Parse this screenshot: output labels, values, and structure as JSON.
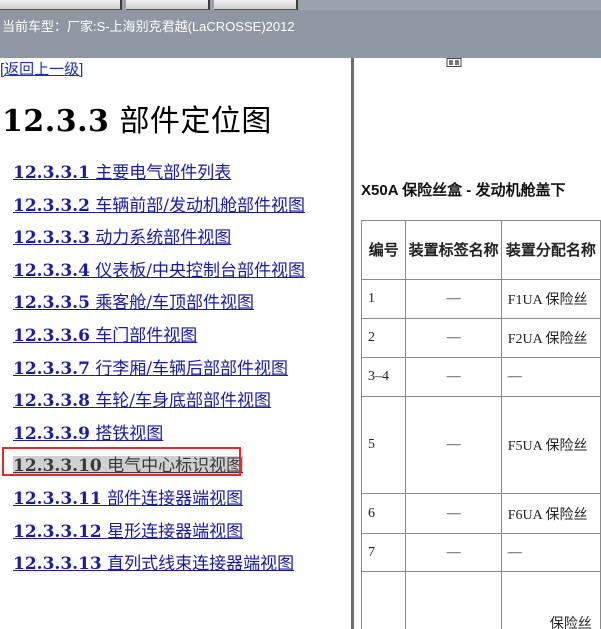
{
  "vehicle_bar": {
    "label": "当前车型：",
    "value": "厂家:S-上海别克君越(LaCROSSE)2012"
  },
  "nav": {
    "back_label": "[返回上一级]",
    "title_number": "12.3.3",
    "title_text": "部件定位图"
  },
  "toc": [
    {
      "num": "12.3.3.1",
      "label": "主要电气部件列表"
    },
    {
      "num": "12.3.3.2",
      "label": "车辆前部/发动机舱部件视图"
    },
    {
      "num": "12.3.3.3",
      "label": "动力系统部件视图"
    },
    {
      "num": "12.3.3.4",
      "label": "仪表板/中央控制台部件视图"
    },
    {
      "num": "12.3.3.5",
      "label": "乘客舱/车顶部件视图"
    },
    {
      "num": "12.3.3.6",
      "label": "车门部件视图"
    },
    {
      "num": "12.3.3.7",
      "label": "行李厢/车辆后部部件视图"
    },
    {
      "num": "12.3.3.8",
      "label": "车轮/车身底部部件视图"
    },
    {
      "num": "12.3.3.9",
      "label": "搭铁视图"
    },
    {
      "num": "12.3.3.10",
      "label": "电气中心标识视图"
    },
    {
      "num": "12.3.3.11",
      "label": "部件连接器端视图"
    },
    {
      "num": "12.3.3.12",
      "label": "星形连接器端视图"
    },
    {
      "num": "12.3.3.13",
      "label": "直列式线束连接器端视图"
    }
  ],
  "current_toc_index": 9,
  "fuse_section": {
    "title": "X50A 保险丝盒 - 发动机舱盖下",
    "headers": [
      "编号",
      "装置标签名称",
      "装置分配名称"
    ],
    "rows": [
      [
        "1",
        "—",
        "F1UA 保险丝"
      ],
      [
        "2",
        "—",
        "F2UA 保险丝"
      ],
      [
        "3–4",
        "—",
        "—"
      ],
      [
        "5",
        "—",
        "F5UA 保险丝"
      ],
      [
        "6",
        "—",
        "F6UA 保险丝"
      ],
      [
        "7",
        "—",
        "—"
      ],
      [
        "",
        "",
        "保险丝"
      ]
    ]
  },
  "colors": {
    "link": "#1a1aa8",
    "highlight_border": "#e02b2b",
    "vehicle_bar_bg": "#8e97a2"
  }
}
